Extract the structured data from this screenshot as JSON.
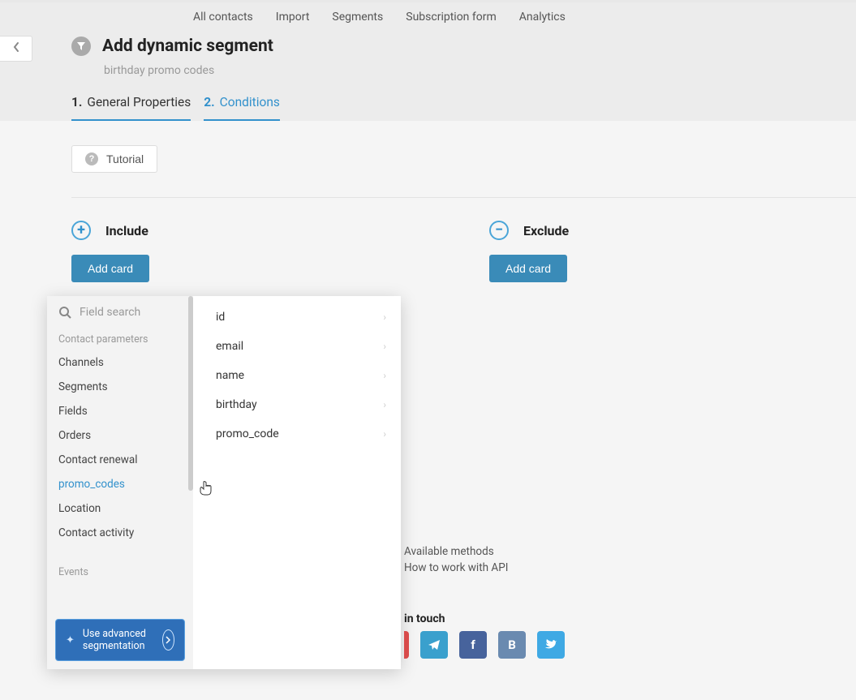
{
  "topnav": {
    "items": [
      "All contacts",
      "Import",
      "Segments",
      "Subscription form",
      "Analytics"
    ]
  },
  "page": {
    "title": "Add dynamic segment",
    "subtitle": "birthday promo codes"
  },
  "tabs": {
    "step1": {
      "num": "1.",
      "label": "General Properties"
    },
    "step2": {
      "num": "2.",
      "label": "Conditions"
    }
  },
  "tutorial": {
    "label": "Tutorial"
  },
  "include": {
    "title": "Include",
    "button": "Add card"
  },
  "exclude": {
    "title": "Exclude",
    "button": "Add card"
  },
  "dropdown": {
    "search_placeholder": "Field search",
    "group1": "Contact parameters",
    "items1": [
      "Channels",
      "Segments",
      "Fields",
      "Orders",
      "Contact renewal",
      "promo_codes",
      "Location",
      "Contact activity"
    ],
    "selected_index": 5,
    "group2": "Events",
    "promo": "Use advanced segmentation",
    "fields": [
      "id",
      "email",
      "name",
      "birthday",
      "promo_code"
    ]
  },
  "footer": {
    "line1": "Available methods",
    "line2": "How to work with API",
    "heading": "in touch"
  },
  "social": {
    "teal_label": "~",
    "fb_label": "f",
    "vk_label": "B",
    "tw_label": "t"
  }
}
